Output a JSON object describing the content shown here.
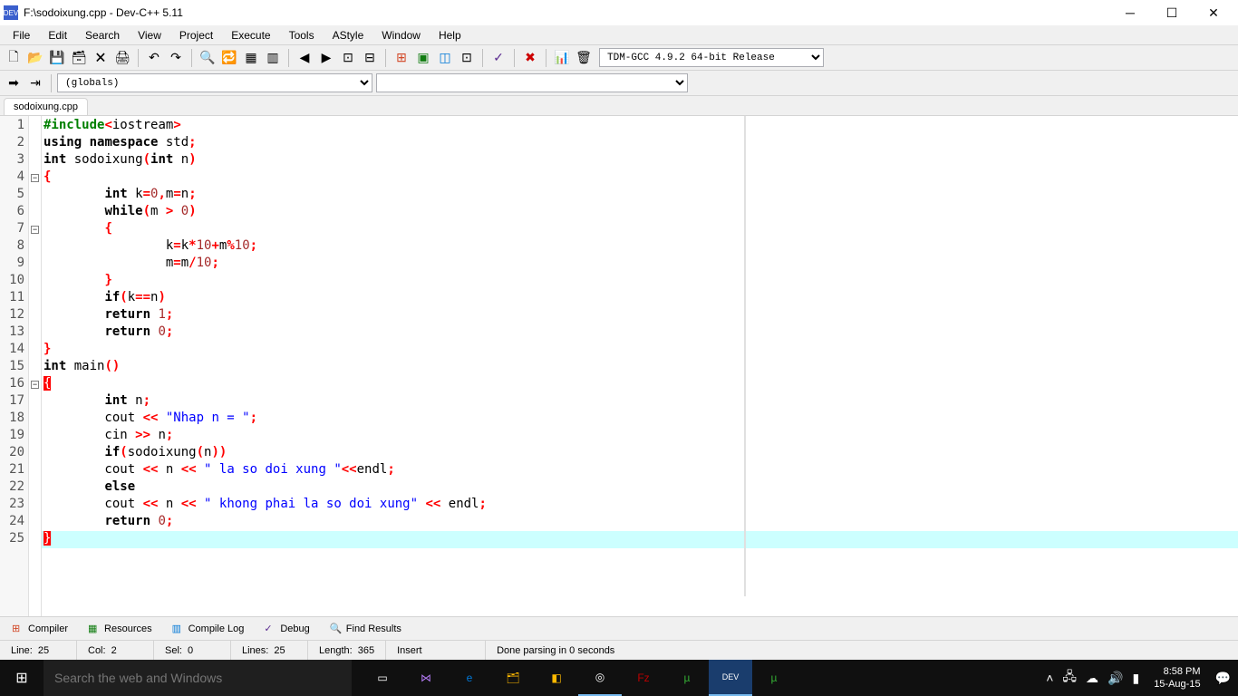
{
  "titlebar": {
    "title": "F:\\sodoixung.cpp - Dev-C++ 5.11",
    "icon_text": "DEV"
  },
  "menu": [
    "File",
    "Edit",
    "Search",
    "View",
    "Project",
    "Execute",
    "Tools",
    "AStyle",
    "Window",
    "Help"
  ],
  "compiler_select": "TDM-GCC 4.9.2 64-bit Release",
  "globals_select": "(globals)",
  "tabs": [
    "sodoixung.cpp"
  ],
  "code": {
    "line_count": 25,
    "fold_rows": {
      "4": "-",
      "7": "-",
      "16": "-"
    }
  },
  "bottom_tabs": [
    {
      "icon": "⊞",
      "label": "Compiler",
      "color": "#d24726"
    },
    {
      "icon": "▦",
      "label": "Resources",
      "color": "#107c10"
    },
    {
      "icon": "▥",
      "label": "Compile Log",
      "color": "#0078d7"
    },
    {
      "icon": "✓",
      "label": "Debug",
      "color": "#5c2d91"
    },
    {
      "icon": "🔍",
      "label": "Find Results",
      "color": "#444"
    }
  ],
  "statusbar": {
    "line_label": "Line:",
    "line": "25",
    "col_label": "Col:",
    "col": "2",
    "sel_label": "Sel:",
    "sel": "0",
    "lines_label": "Lines:",
    "lines": "25",
    "length_label": "Length:",
    "length": "365",
    "mode": "Insert",
    "status": "Done parsing in 0 seconds"
  },
  "taskbar": {
    "search_placeholder": "Search the web and Windows",
    "time": "8:58 PM",
    "date": "15-Aug-15"
  }
}
